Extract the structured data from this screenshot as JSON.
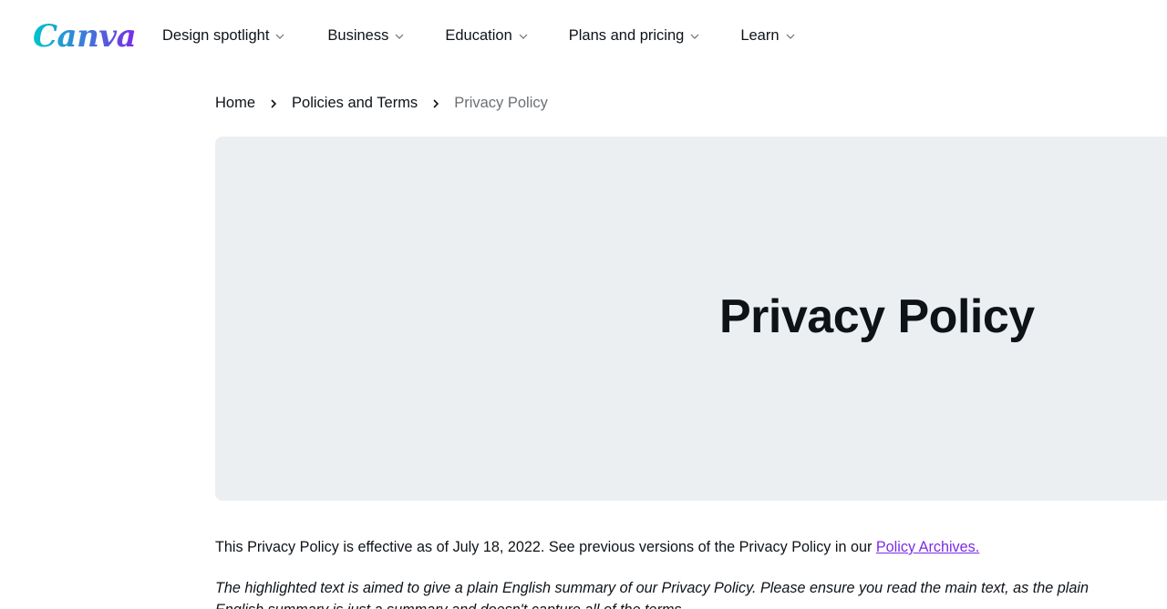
{
  "header": {
    "logo_text": "Canva",
    "nav": [
      {
        "label": "Design spotlight"
      },
      {
        "label": "Business"
      },
      {
        "label": "Education"
      },
      {
        "label": "Plans and pricing"
      },
      {
        "label": "Learn"
      }
    ]
  },
  "breadcrumb": {
    "home": "Home",
    "section": "Policies and Terms",
    "current": "Privacy Policy"
  },
  "hero": {
    "title": "Privacy Policy"
  },
  "content": {
    "effective_text": "This Privacy Policy is effective as of July 18, 2022. See previous versions of the Privacy Policy in our ",
    "archives_link": "Policy Archives.",
    "summary": "The highlighted text is aimed to give a plain English summary of our Privacy Policy. Please ensure you read the main text, as the plain English summary is just a summary and doesn't capture all of the terms."
  },
  "colors": {
    "link": "#7d2ae8",
    "hero_bg": "#eceff1",
    "logo_gradient_start": "#00c4cc",
    "logo_gradient_end": "#7d2ae8"
  },
  "icons": [
    "chevron-down-icon",
    "chevron-right-icon"
  ]
}
